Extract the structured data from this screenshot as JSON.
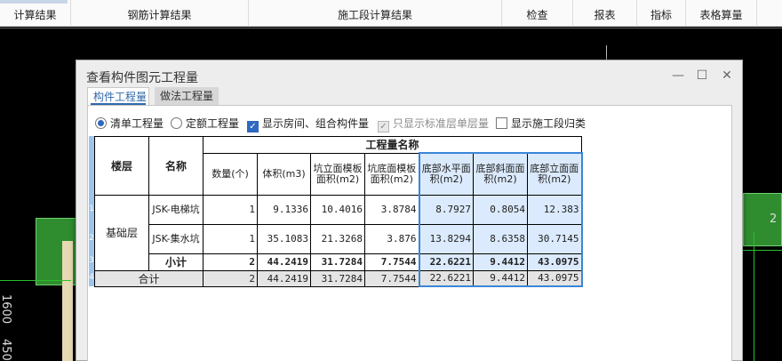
{
  "ribbon": {
    "items": [
      {
        "label": "计算结果"
      },
      {
        "label": "钢筋计算结果"
      },
      {
        "label": "施工段计算结果"
      },
      {
        "label": "检查"
      },
      {
        "label": "报表"
      },
      {
        "label": "指标"
      },
      {
        "label": "表格算量"
      }
    ]
  },
  "cad": {
    "label_a": "2",
    "label_b": "1600",
    "label_c": "450"
  },
  "dialog": {
    "title": "查看构件图元工程量",
    "tabs": [
      {
        "label": "构件工程量"
      },
      {
        "label": "做法工程量"
      }
    ],
    "options": {
      "qd": "清单工程量",
      "de": "定额工程量",
      "show_room": "显示房间、组合构件量",
      "std_floor": "只显示标准层单层量",
      "show_stage": "显示施工段归类"
    },
    "table": {
      "h_floor": "楼层",
      "h_name": "名称",
      "h_group": "工程量名称",
      "cols": [
        "数量(个)",
        "体积(m3)",
        "坑立面模板面积(m2)",
        "坑底面模板面积(m2)",
        "底部水平面积(m2)",
        "底部斜面面积(m2)",
        "底部立面面积(m2)"
      ],
      "floor": "基础层",
      "row_numbers": [
        "1",
        "2",
        "3",
        "4"
      ],
      "rows": [
        {
          "name": "JSK-电梯坑",
          "v": [
            "1",
            "9.1336",
            "10.4016",
            "3.8784",
            "8.7927",
            "0.8054",
            "12.383"
          ]
        },
        {
          "name": "JSK-集水坑",
          "v": [
            "1",
            "35.1083",
            "21.3268",
            "3.876",
            "13.8294",
            "8.6358",
            "30.7145"
          ]
        }
      ],
      "subtotal": {
        "name": "小计",
        "v": [
          "2",
          "44.2419",
          "31.7284",
          "7.7544",
          "22.6221",
          "9.4412",
          "43.0975"
        ]
      },
      "total": {
        "name": "合计",
        "v": [
          "2",
          "44.2419",
          "31.7284",
          "7.7544",
          "22.6221",
          "9.4412",
          "43.0975"
        ]
      }
    }
  }
}
